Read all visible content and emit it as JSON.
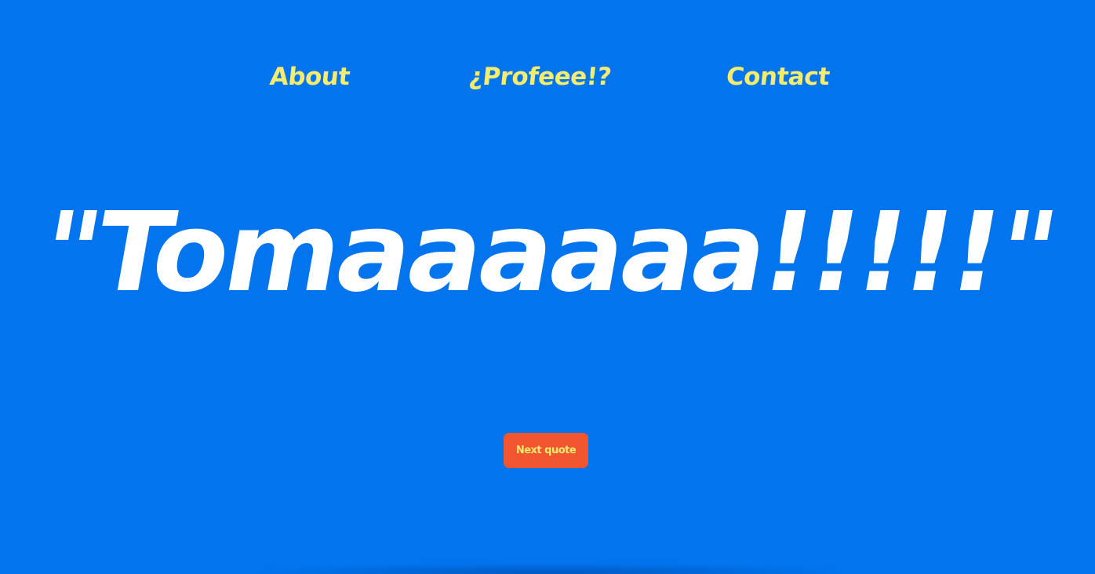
{
  "nav": {
    "items": [
      {
        "label": "About"
      },
      {
        "label": "¿Profeee!?"
      },
      {
        "label": "Contact"
      }
    ]
  },
  "quote": {
    "text": "\"Tomaaaaaa!!!!!\""
  },
  "actions": {
    "next_label": "Next quote"
  },
  "colors": {
    "background": "#0174ee",
    "nav_text": "#f6ec6e",
    "quote_text": "#ffffff",
    "button_bg": "#f25631",
    "button_text": "#f6ec6e"
  }
}
